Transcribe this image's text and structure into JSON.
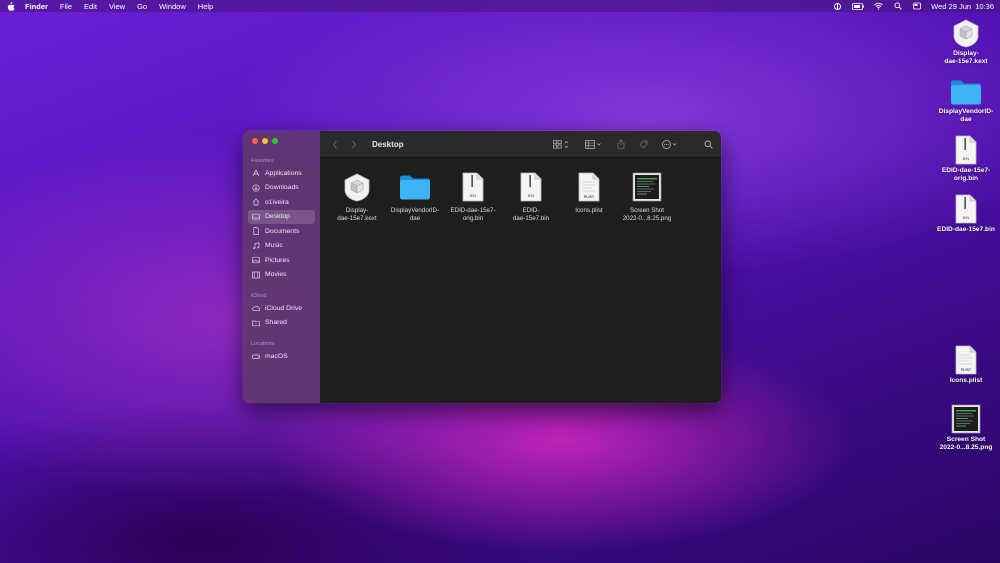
{
  "menubar": {
    "app": "Finder",
    "items": [
      "File",
      "Edit",
      "View",
      "Go",
      "Window",
      "Help"
    ],
    "datetime": "Wed 29 Jun  10:36"
  },
  "desktop_icons": [
    {
      "label_line1": "Display-",
      "label_line2": "dae-15e7.kext",
      "icon": "kext-icon"
    },
    {
      "label_line1": "DisplayVendorID-",
      "label_line2": "dae",
      "icon": "folder-icon"
    },
    {
      "label_line1": "EDID-dae-15e7-",
      "label_line2": "orig.bin",
      "icon": "bin-file-icon"
    },
    {
      "label_line1": "EDID-dae-15e7.bin",
      "label_line2": "",
      "icon": "bin-file-icon"
    },
    {
      "label_line1": "Icons.plist",
      "label_line2": "",
      "icon": "plist-file-icon"
    },
    {
      "label_line1": "Screen Shot",
      "label_line2": "2022-0...8.25.png",
      "icon": "screenshot-icon"
    }
  ],
  "finder": {
    "title": "Desktop",
    "sidebar": {
      "favorites_header": "Favorites",
      "favorites": [
        "Applications",
        "Downloads",
        "o1iveira",
        "Desktop",
        "Documents",
        "Music",
        "Pictures",
        "Movies"
      ],
      "icloud_header": "iCloud",
      "icloud": [
        "iCloud Drive",
        "Shared"
      ],
      "locations_header": "Locations",
      "locations": [
        "macOS"
      ]
    },
    "files": [
      {
        "line1": "Display-",
        "line2": "dae-15e7.kext",
        "icon": "kext-icon"
      },
      {
        "line1": "DisplayVendorID-",
        "line2": "dae",
        "icon": "folder-icon"
      },
      {
        "line1": "EDID-dae-15e7-",
        "line2": "orig.bin",
        "icon": "bin-file-icon"
      },
      {
        "line1": "EDID-",
        "line2": "dae-15e7.bin",
        "icon": "bin-file-icon"
      },
      {
        "line1": "Icons.plist",
        "line2": "",
        "icon": "plist-file-icon"
      },
      {
        "line1": "Screen Shot",
        "line2": "2022-0...8.25.png",
        "icon": "screenshot-icon"
      }
    ],
    "file_badges": {
      "bin": "BIN",
      "plist": "PLIST"
    }
  },
  "colors": {
    "close": "#ff5f57",
    "minimize": "#febc2e",
    "zoom": "#28c840",
    "folder": "#1ea0ee"
  }
}
